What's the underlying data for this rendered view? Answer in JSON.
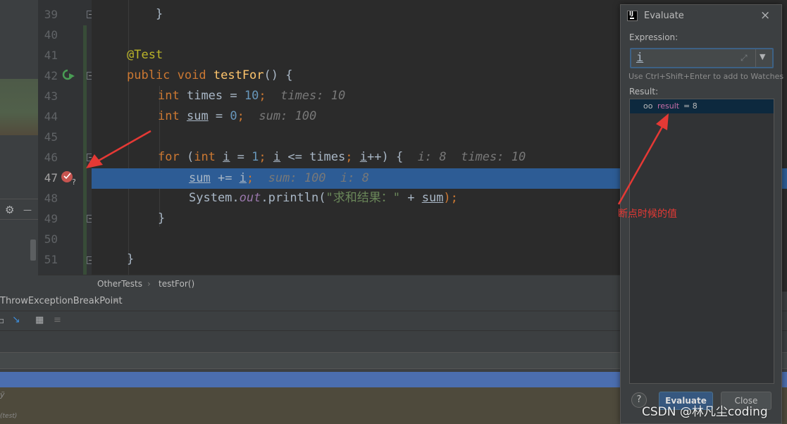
{
  "editor": {
    "lines": [
      {
        "num": "39",
        "text": "    }"
      },
      {
        "num": "40",
        "text": ""
      },
      {
        "num": "41",
        "annotation": "@Test"
      },
      {
        "num": "42",
        "kw1": "public",
        "kw2": "void",
        "method": "testFor",
        "rest": "() {"
      },
      {
        "num": "43",
        "kw": "int",
        "name": "times",
        "eq": " = ",
        "value": "10",
        "semi": ";",
        "inline": "times: 10"
      },
      {
        "num": "44",
        "kw": "int",
        "name": "sum",
        "eq": " = ",
        "value": "0",
        "semi": ";",
        "inline": "sum: 100"
      },
      {
        "num": "45",
        "text": ""
      },
      {
        "num": "46",
        "kw_for": "for",
        "paren": " (",
        "kw_int": "int",
        "var": "i",
        "eq": " = ",
        "one": "1",
        "semi1": ";",
        "cond_var": "i",
        "cond": " <= times",
        "semi2": ";",
        "inc_var": "i",
        "inc": "++) {",
        "inline": "i: 8  times: 10"
      },
      {
        "num": "47",
        "target": "sum",
        "op": " += ",
        "var": "i",
        "semi": ";",
        "inline": "sum: 100  i: 8"
      },
      {
        "num": "48",
        "cls": "System.",
        "field": "out",
        "call": ".println(",
        "str": "\"求和结果：\"",
        "plus": " + ",
        "var": "sum",
        "end": ");"
      },
      {
        "num": "49",
        "text": "}"
      },
      {
        "num": "50",
        "text": ""
      },
      {
        "num": "51",
        "text": "}"
      }
    ],
    "breadcrumb": {
      "class_name": "OtherTests",
      "method_name": "testFor()"
    }
  },
  "debug_panel": {
    "tab_label": "ThrowExceptionBreakPoint",
    "tab_close": "×",
    "frames_text": "ÿ",
    "frames_text2": "(test)"
  },
  "left_toolbar": {
    "gear": "⚙",
    "minus": "—"
  },
  "evaluate_dialog": {
    "title": "Evaluate",
    "close": "×",
    "expression_label": "Expression:",
    "expression_value": "i",
    "hint": "Use Ctrl+Shift+Enter to add to Watches",
    "result_label": "Result:",
    "result_name": "result",
    "result_value": " = 8",
    "help": "?",
    "evaluate_button": "Evaluate",
    "close_button": "Close"
  },
  "annotation_note": "断点时候的值",
  "watermark": "CSDN @林凡尘coding",
  "colors": {
    "arrow": "#e53935",
    "highlight_line": "#2d5c95",
    "breakpoint": "#c75450"
  }
}
